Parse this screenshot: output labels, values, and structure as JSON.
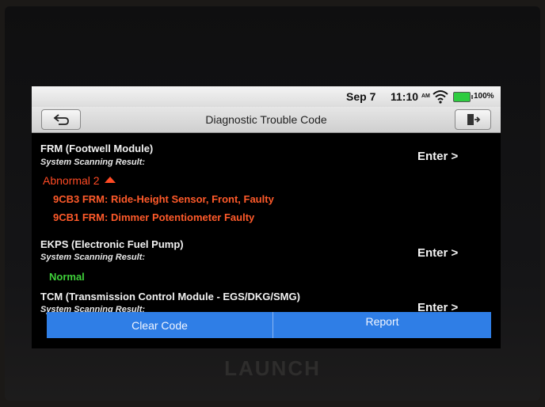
{
  "status_bar": {
    "date": "Sep 7",
    "time": "11:10",
    "ampm": "AM",
    "battery": "100%",
    "icons": [
      "wifi-icon",
      "battery-icon"
    ],
    "battery_level": 1.0
  },
  "header": {
    "title": "Diagnostic Trouble Code",
    "back_icon": "back-arrow-icon",
    "exit_icon": "exit-icon"
  },
  "modules": [
    {
      "name": "FRM (Footwell Module)",
      "scan_label": "System Scanning Result:",
      "result": "Abnormal 2",
      "enter": "Enter >",
      "dtcs": [
        "9CB3 FRM: Ride-Height Sensor, Front, Faulty",
        "9CB1 FRM: Dimmer Potentiometer Faulty"
      ]
    },
    {
      "name": "EKPS (Electronic Fuel Pump)",
      "scan_label": "System Scanning Result:",
      "result": "Normal",
      "enter": "Enter >"
    },
    {
      "name": "TCM (Transmission Control Module - EGS/DKG/SMG)",
      "scan_label": "System Scanning Result:",
      "enter": "Enter >"
    }
  ],
  "actions": {
    "clear_code": "Clear Code",
    "report": "Report"
  },
  "brand": "LAUNCH",
  "colors": {
    "abnormal": "#ff4a24",
    "normal": "#3fd13a",
    "action_bar": "#2f7ee6"
  }
}
